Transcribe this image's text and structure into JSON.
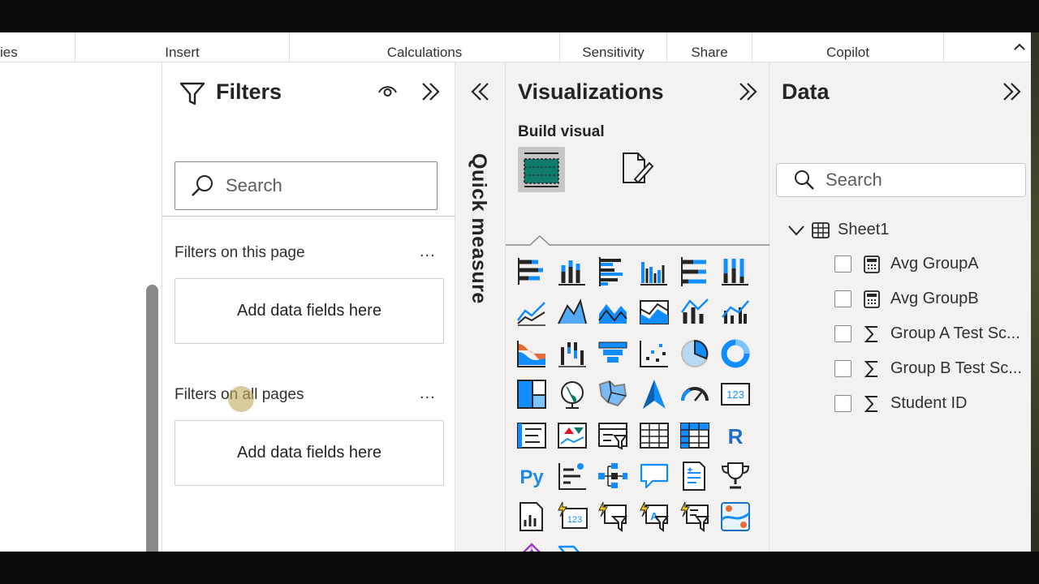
{
  "ribbon": {
    "groups": [
      "ies",
      "Insert",
      "Calculations",
      "Sensitivity",
      "Share",
      "Copilot"
    ],
    "collapse_icon": "chevron-up-icon"
  },
  "filters": {
    "title": "Filters",
    "search_placeholder": "Search",
    "section_page": "Filters on this page",
    "section_all": "Filters on all pages",
    "drop_page": "Add data fields here",
    "drop_all": "Add data fields here",
    "more": "..."
  },
  "quick_measure": {
    "label": "Quick measure"
  },
  "visualizations": {
    "title": "Visualizations",
    "build_visual": "Build visual",
    "more": "...",
    "icons": [
      "stacked-bar-icon",
      "stacked-column-icon",
      "clustered-bar-icon",
      "clustered-column-icon",
      "100-stacked-bar-icon",
      "100-stacked-column-icon",
      "line-chart-icon",
      "area-chart-icon",
      "stacked-area-icon",
      "100-stacked-area-icon",
      "line-stacked-column-icon",
      "line-clustered-column-icon",
      "ribbon-chart-icon",
      "waterfall-icon",
      "funnel-icon",
      "scatter-icon",
      "pie-chart-icon",
      "donut-chart-icon",
      "treemap-icon",
      "map-icon",
      "filled-map-icon",
      "azure-map-icon",
      "gauge-icon",
      "card-icon",
      "multirow-card-icon",
      "kpi-icon",
      "slicer-icon",
      "table-icon",
      "matrix-icon",
      "r-visual-icon",
      "python-visual-icon",
      "key-influencers-icon",
      "decomposition-tree-icon",
      "qa-icon",
      "smart-narrative-icon",
      "metrics-icon",
      "paginated-report-icon",
      "card-new-icon",
      "slicer-new-icon",
      "text-slicer-icon",
      "button-slicer-icon",
      "arcgis-icon",
      "power-apps-icon",
      "power-automate-icon"
    ]
  },
  "data": {
    "title": "Data",
    "search_placeholder": "Search",
    "table": "Sheet1",
    "fields": [
      {
        "name": "Avg GroupA",
        "type": "measure"
      },
      {
        "name": "Avg GroupB",
        "type": "measure"
      },
      {
        "name": "Group A Test Sc...",
        "type": "sum"
      },
      {
        "name": "Group B Test Sc...",
        "type": "sum"
      },
      {
        "name": "Student ID",
        "type": "sum"
      }
    ]
  }
}
